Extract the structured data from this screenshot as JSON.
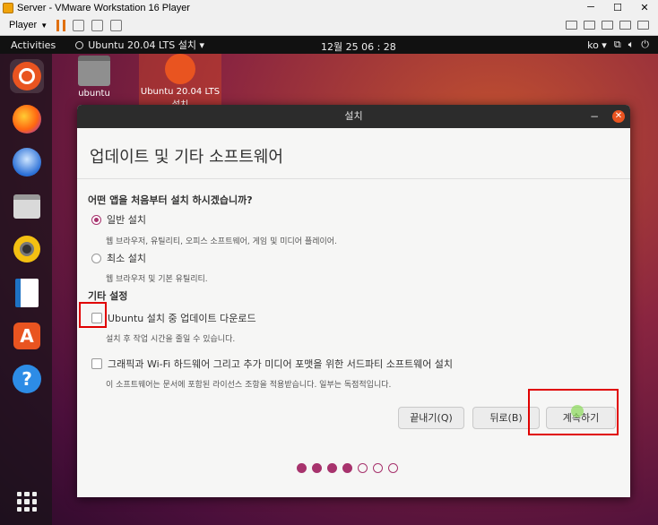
{
  "vmware": {
    "title": "Server - VMware Workstation 16 Player",
    "player_label": "Player"
  },
  "topbar": {
    "activities": "Activities",
    "app_menu": "Ubuntu 20.04 LTS 설치 ▾",
    "clock": "12월 25  06 : 28",
    "input_method": "ko ▾",
    "tray_icons": [
      "network-icon",
      "volume-icon",
      "power-icon"
    ]
  },
  "dock": {
    "items": [
      "ubuntu-installer",
      "firefox",
      "thunderbird-mail",
      "files",
      "rhythmbox",
      "libreoffice-writer",
      "ubuntu-software",
      "help",
      "show-applications"
    ]
  },
  "desktop_icons": [
    {
      "label": "ubuntu"
    },
    {
      "label": "Ubuntu 20.04 LTS 설치"
    }
  ],
  "dialog": {
    "window_title": "설치",
    "heading": "업데이트 및 기타 소프트웨어",
    "question": "어떤 앱을 처음부터 설치 하시겠습니까?",
    "options": [
      {
        "label": "일반 설치",
        "desc": "웹 브라우저, 유틸리티, 오피스 소프트웨어, 게임 및 미디어 플레이어.",
        "selected": true
      },
      {
        "label": "최소 설치",
        "desc": "웹 브라우저 및 기본 유틸리티.",
        "selected": false
      }
    ],
    "other_settings": "기타 설정",
    "checks": [
      {
        "label": "Ubuntu 설치 중 업데이트 다운로드",
        "desc": "설치 후 작업 시간을 줄일 수 있습니다.",
        "checked": false
      },
      {
        "label": "그래픽과 Wi-Fi 하드웨어 그리고 추가 미디어 포맷을 위한 서드파티 소프트웨어 설치",
        "desc": "이 소프트웨어는 문서에 포함된 라이선스 조항을 적용받습니다. 일부는 독점적입니다.",
        "checked": false
      }
    ],
    "buttons": {
      "quit": "끝내기(Q)",
      "back": "뒤로(B)",
      "continue": "계속하기"
    },
    "progress": {
      "total": 7,
      "completed": 4
    }
  }
}
